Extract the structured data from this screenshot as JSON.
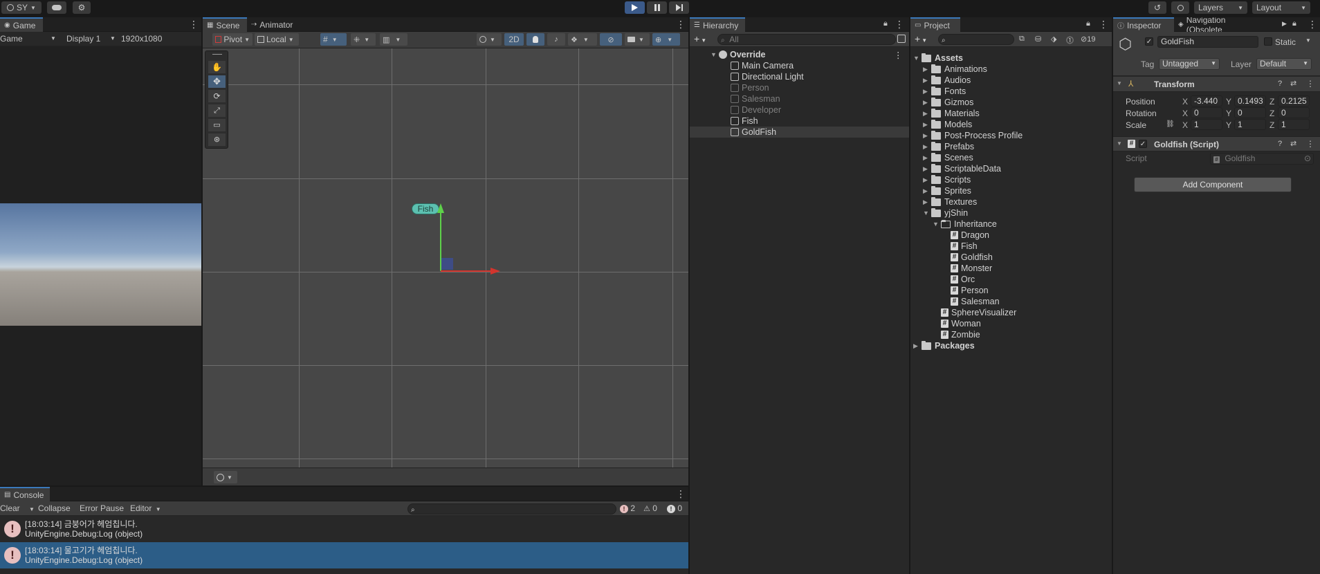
{
  "topbar": {
    "account": "SY",
    "layers_label": "Layers",
    "layout_label": "Layout"
  },
  "game": {
    "tab": "Game",
    "mode": "Game",
    "display": "Display 1",
    "resolution": "1920x1080"
  },
  "scene": {
    "tab_scene": "Scene",
    "tab_animator": "Animator",
    "pivot": "Pivot",
    "local": "Local",
    "mode_2d": "2D",
    "object_label": "Fish"
  },
  "hierarchy": {
    "title": "Hierarchy",
    "search_placeholder": "All",
    "scene_name": "Override",
    "items": [
      {
        "label": "Main Camera",
        "dim": false
      },
      {
        "label": "Directional Light",
        "dim": false
      },
      {
        "label": "Person",
        "dim": true
      },
      {
        "label": "Salesman",
        "dim": true
      },
      {
        "label": "Developer",
        "dim": true
      },
      {
        "label": "Fish",
        "dim": false
      },
      {
        "label": "GoldFish",
        "dim": false
      }
    ]
  },
  "project": {
    "title": "Project",
    "hidden_count": "19",
    "root": "Assets",
    "folders": [
      "Animations",
      "Audios",
      "Fonts",
      "Gizmos",
      "Materials",
      "Models",
      "Post-Process Profile",
      "Prefabs",
      "Scenes",
      "ScriptableData",
      "Scripts",
      "Sprites",
      "Textures"
    ],
    "yj_folder": "yjShin",
    "inheritance_folder": "Inheritance",
    "inheritance_scripts": [
      "Dragon",
      "Fish",
      "Goldfish",
      "Monster",
      "Orc",
      "Person",
      "Salesman"
    ],
    "yj_scripts": [
      "SphereVisualizer",
      "Woman",
      "Zombie"
    ],
    "packages": "Packages"
  },
  "inspector": {
    "tab_inspector": "Inspector",
    "tab_navigation": "Navigation (Obsolete",
    "object_name": "GoldFish",
    "static_label": "Static",
    "tag_label": "Tag",
    "tag_value": "Untagged",
    "layer_label": "Layer",
    "layer_value": "Default",
    "transform_title": "Transform",
    "position_label": "Position",
    "rotation_label": "Rotation",
    "scale_label": "Scale",
    "position": {
      "x": "-3.440",
      "y": "0.1493",
      "z": "0.2125"
    },
    "rotation": {
      "x": "0",
      "y": "0",
      "z": "0"
    },
    "scale": {
      "x": "1",
      "y": "1",
      "z": "1"
    },
    "axis_x": "X",
    "axis_y": "Y",
    "axis_z": "Z",
    "script_component": "Goldfish (Script)",
    "script_label": "Script",
    "script_value": "Goldfish",
    "add_component": "Add Component"
  },
  "console": {
    "title": "Console",
    "clear": "Clear",
    "collapse": "Collapse",
    "error_pause": "Error Pause",
    "editor": "Editor",
    "error_count": "2",
    "warning_count": "0",
    "info_count": "0",
    "logs": [
      {
        "line1": "[18:03:14] 금붕어가 헤엄칩니다.",
        "line2": "UnityEngine.Debug:Log (object)",
        "selected": false
      },
      {
        "line1": "[18:03:14] 물고기가 헤엄칩니다.",
        "line2": "UnityEngine.Debug:Log (object)",
        "selected": true
      }
    ]
  },
  "colors": {
    "accent": "#3a79bb",
    "selected_row": "#2c5d87",
    "error_icon": "#e7bfbf"
  }
}
